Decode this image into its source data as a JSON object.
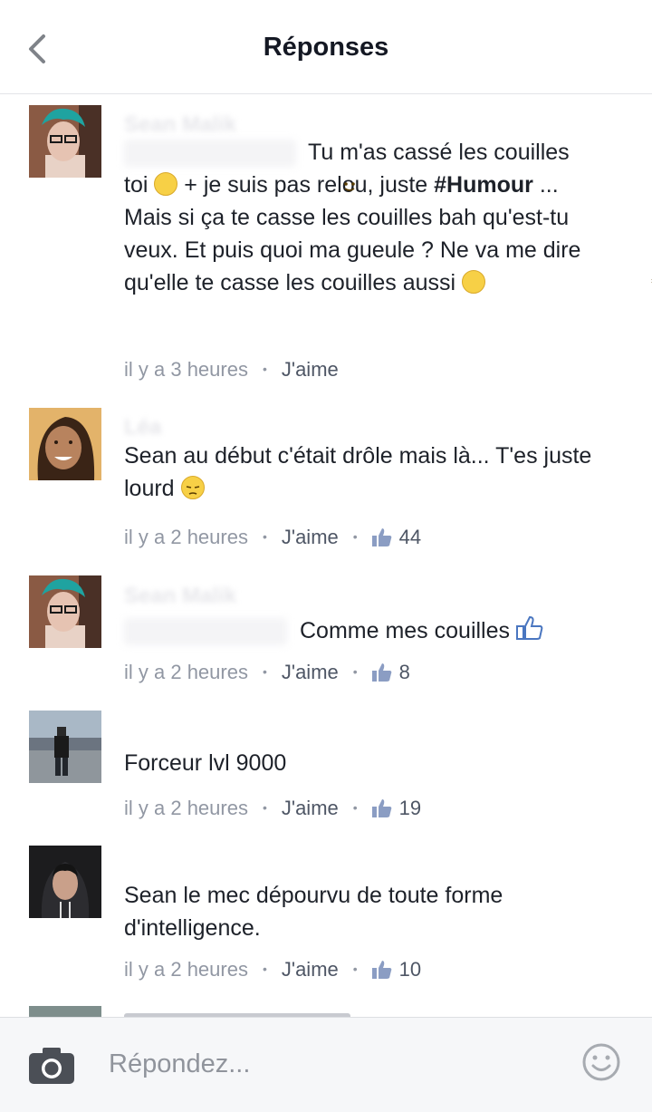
{
  "header": {
    "title": "Réponses",
    "back_icon": "chevron-left-icon"
  },
  "comments": [
    {
      "author": "Sean Malik",
      "text_parts": [
        "Tu m'as cassé les couilles toi ",
        " + je suis pas relou, juste "
      ],
      "hashtag": "#Humour",
      "text_after_hashtag": " ... Mais si ça te casse les couilles bah qu'est-tu veux. Et puis quoi ma gueule ? Ne va me dire qu'elle te casse les couilles aussi ",
      "emojis": [
        "slight-smile-emoji",
        "dizzy-face-emoji"
      ],
      "time": "il y a 3 heures",
      "like_label": "J'aime"
    },
    {
      "author": "Léa",
      "text": "Sean au début c'était drôle mais là... T'es juste lourd ",
      "emoji": "unamused-face-emoji",
      "time": "il y a 2 heures",
      "like_label": "J'aime",
      "likes": "44"
    },
    {
      "author": "Sean Malik",
      "text": "Comme mes couilles ",
      "emoji": "thumbs-up-emoji",
      "time": "il y a 2 heures",
      "like_label": "J'aime",
      "likes": "8"
    },
    {
      "author": "",
      "text": "Forceur lvl 9000",
      "time": "il y a 2 heures",
      "like_label": "J'aime",
      "likes": "19"
    },
    {
      "author": "",
      "text": "Sean le mec dépourvu de toute forme d'intelligence.",
      "time": "il y a 2 heures",
      "like_label": "J'aime",
      "likes": "10"
    }
  ],
  "composer": {
    "placeholder": "Répondez...",
    "camera_icon": "camera-icon",
    "emoji_icon": "smiley-icon"
  },
  "colors": {
    "like_blue": "#4e5665",
    "meta_gray": "#9197a3",
    "accent": "#4267b2"
  }
}
